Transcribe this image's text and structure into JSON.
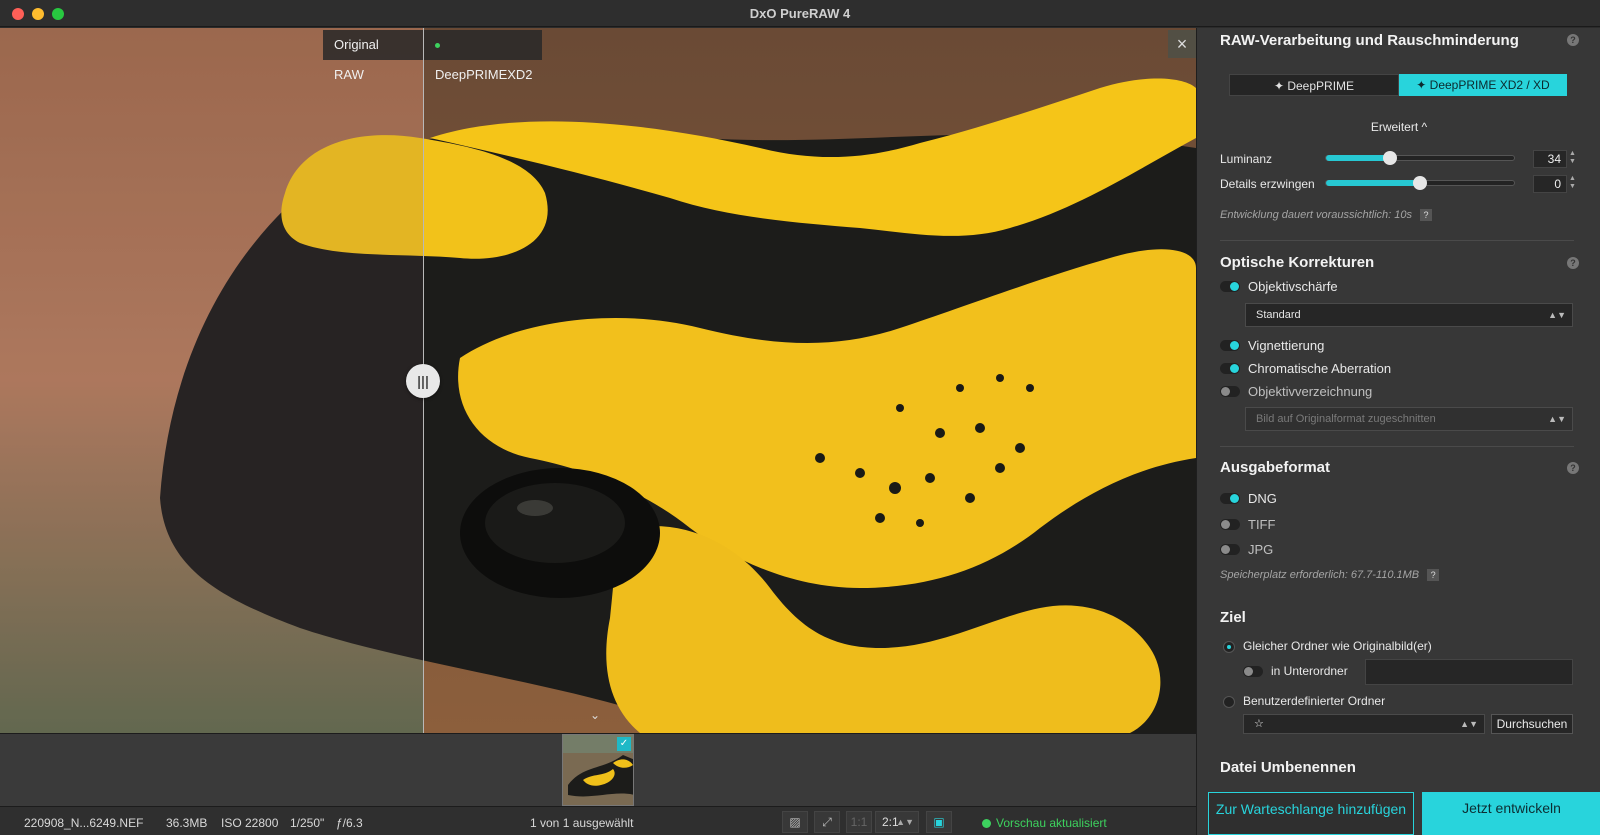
{
  "window": {
    "title": "DxO PureRAW 4"
  },
  "viewer": {
    "label_left": "Original RAW",
    "label_right": "DeepPRIMEXD2",
    "split_handle": "|||",
    "close": "×",
    "expand": "⌄"
  },
  "filmstrip": {
    "thumb_check": "✓"
  },
  "statusbar": {
    "filename": "220908_N...6249.NEF",
    "filesize": "36.3MB",
    "iso": "ISO 22800",
    "shutter": "1/250\"",
    "aperture": "ƒ/6.3",
    "selection": "1 von 1 ausgewählt",
    "zoom_one": "1:1",
    "zoom_value": "2:1",
    "preview_status": "Vorschau aktualisiert"
  },
  "panel": {
    "raw_section": {
      "title": "RAW-Verarbeitung und Rauschminderung",
      "modes": [
        "✦ DeepPRIME",
        "✦ DeepPRIME XD2 / XD"
      ],
      "active_mode": 1,
      "advanced_label": "Erweitert ^",
      "luminance": {
        "label": "Luminanz",
        "value": "34",
        "fraction": 0.34
      },
      "details": {
        "label": "Details erzwingen",
        "value": "0",
        "fraction": 0.5
      },
      "estimate_note": "Entwicklung dauert voraussichtlich: 10s"
    },
    "optical_section": {
      "title": "Optische Korrekturen",
      "sharpness": {
        "label": "Objektivschärfe",
        "on": true
      },
      "sharpness_select": "Standard",
      "vignetting": {
        "label": "Vignettierung",
        "on": true
      },
      "chromatic": {
        "label": "Chromatische Aberration",
        "on": true
      },
      "distortion": {
        "label": "Objektivverzeichnung",
        "on": false
      },
      "distortion_select": "Bild auf Originalformat zugeschnitten"
    },
    "output_section": {
      "title": "Ausgabeformat",
      "dng": {
        "label": "DNG",
        "on": true
      },
      "tiff": {
        "label": "TIFF",
        "on": false
      },
      "jpg": {
        "label": "JPG",
        "on": false
      },
      "space_note": "Speicherplatz erforderlich: 67.7-110.1MB"
    },
    "target_section": {
      "title": "Ziel",
      "same_folder": "Gleicher Ordner wie Originalbild(er)",
      "subfolder": "in Unterordner",
      "custom_folder": "Benutzerdefinierter Ordner",
      "custom_star": "☆",
      "browse": "Durchsuchen"
    },
    "rename_section": {
      "title": "Datei Umbenennen"
    },
    "help": "?",
    "buttons": {
      "queue": "Zur Warteschlange hinzufügen",
      "develop": "Jetzt entwickeln"
    }
  },
  "colors": {
    "accent": "#28d4dc",
    "status_green": "#3dd25e"
  }
}
